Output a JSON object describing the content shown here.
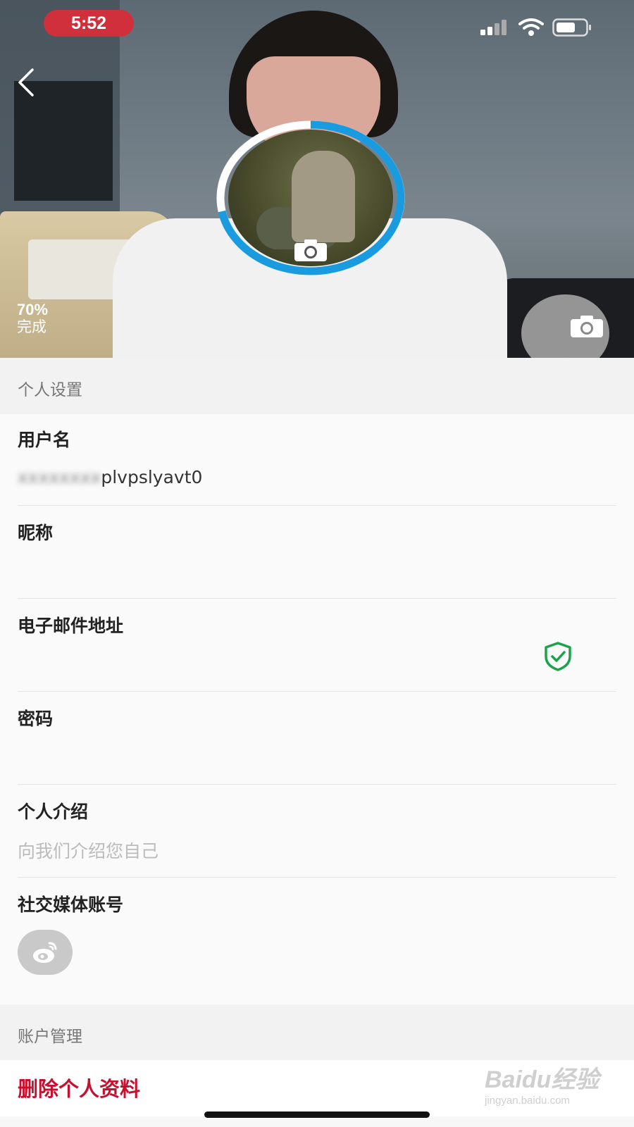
{
  "status_bar": {
    "time": "5:52"
  },
  "profile": {
    "completion_percent": "70%",
    "completion_label": "完成"
  },
  "sections": {
    "personal_settings": "个人设置",
    "account_management": "账户管理"
  },
  "fields": {
    "username": {
      "label": "用户名",
      "value": "plvpslyavt0"
    },
    "nickname": {
      "label": "昵称",
      "value": ""
    },
    "email": {
      "label": "电子邮件地址",
      "value": ""
    },
    "password": {
      "label": "密码",
      "value": ""
    },
    "bio": {
      "label": "个人介绍",
      "placeholder": "向我们介绍您自己"
    },
    "social": {
      "label": "社交媒体账号"
    }
  },
  "actions": {
    "delete_profile": "删除个人资料"
  },
  "watermark": {
    "brand": "Baidu经验",
    "url": "jingyan.baidu.com"
  },
  "colors": {
    "accent_ring": "#1a9be0",
    "danger": "#c8102e",
    "verified": "#1aa34a",
    "time_pill": "#d0303b"
  },
  "icons": [
    "back-chevron-icon",
    "signal-icon",
    "wifi-icon",
    "battery-icon",
    "camera-icon",
    "verified-shield-icon",
    "weibo-icon"
  ]
}
